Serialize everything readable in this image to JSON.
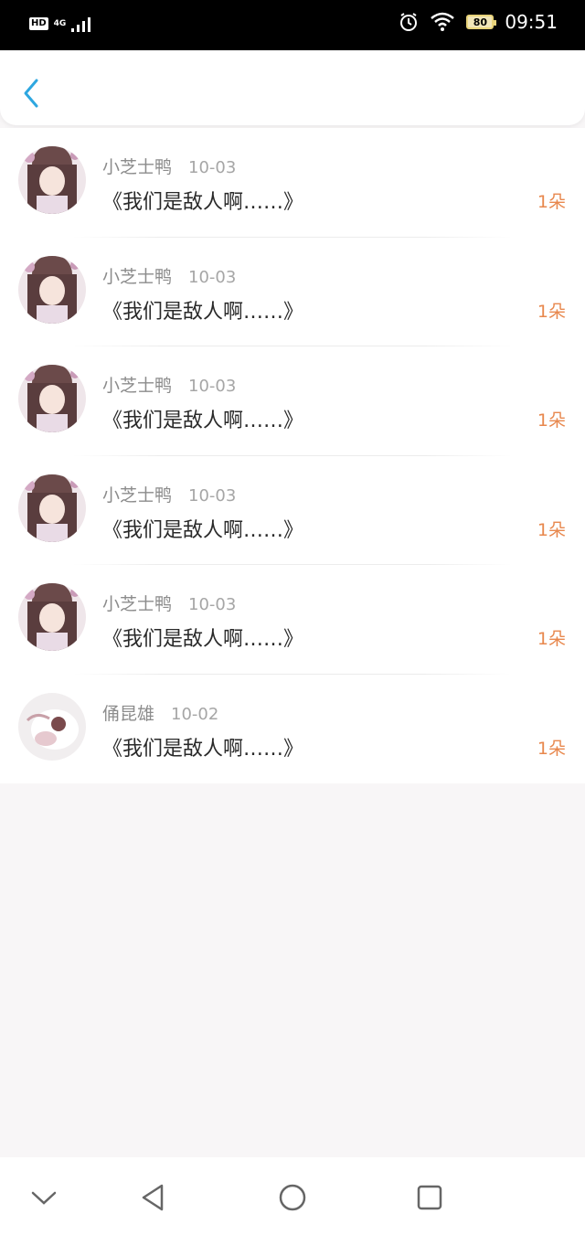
{
  "status_bar": {
    "hd": "HD",
    "network": "4G",
    "battery": "80",
    "time": "09:51"
  },
  "header": {
    "back_icon": "chevron-left-icon"
  },
  "colors": {
    "accent": "#2ea7e0",
    "count_orange": "#e8884e",
    "name_gray": "#8c8c8c"
  },
  "items": [
    {
      "name": "小芝士鸭",
      "date": "10-03",
      "message": "《我们是敌人啊……》",
      "count": "1朵"
    },
    {
      "name": "小芝士鸭",
      "date": "10-03",
      "message": "《我们是敌人啊……》",
      "count": "1朵"
    },
    {
      "name": "小芝士鸭",
      "date": "10-03",
      "message": "《我们是敌人啊……》",
      "count": "1朵"
    },
    {
      "name": "小芝士鸭",
      "date": "10-03",
      "message": "《我们是敌人啊……》",
      "count": "1朵"
    },
    {
      "name": "小芝士鸭",
      "date": "10-03",
      "message": "《我们是敌人啊……》",
      "count": "1朵"
    },
    {
      "name": "俑昆雄",
      "date": "10-02",
      "message": "《我们是敌人啊……》",
      "count": "1朵"
    }
  ],
  "nav": {
    "icons": [
      "chevron-down-icon",
      "back-triangle-icon",
      "home-circle-icon",
      "recents-square-icon"
    ]
  }
}
